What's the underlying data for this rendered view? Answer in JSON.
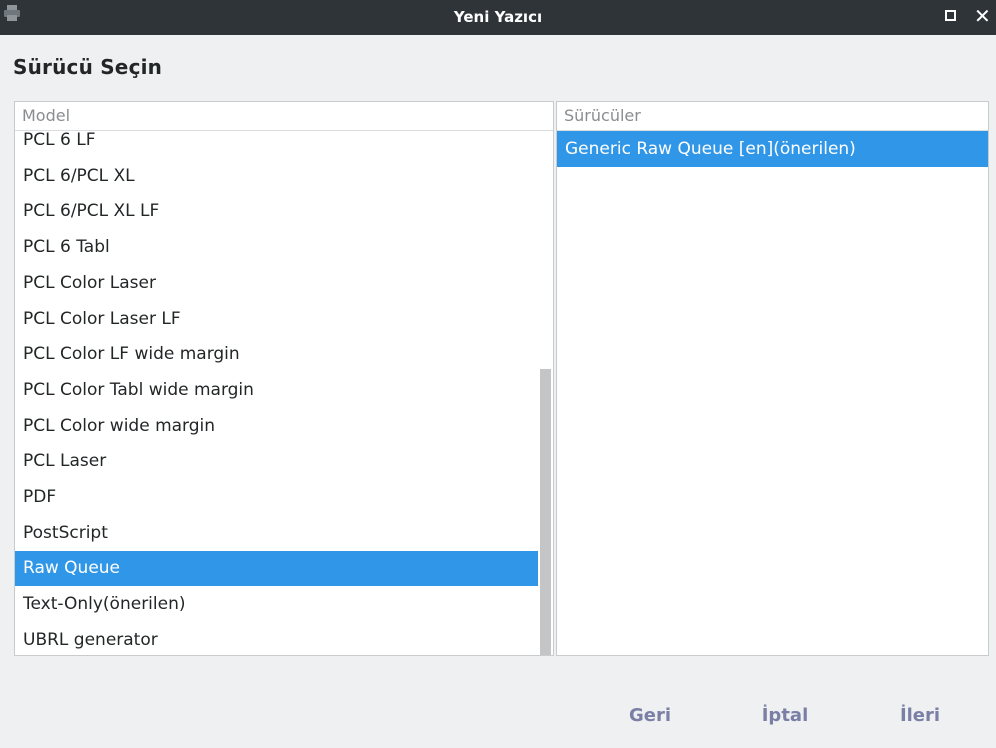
{
  "window": {
    "title": "Yeni Yazıcı",
    "icons": {
      "app": "printer-icon",
      "maximize": "maximize-icon",
      "close": "close-icon"
    },
    "close_glyph": "✕"
  },
  "heading": "Sürücü Seçin",
  "model_list": {
    "header": "Model",
    "items": [
      "PCL 6 LF",
      "PCL 6/PCL XL",
      "PCL 6/PCL XL LF",
      "PCL 6 Tabl",
      "PCL Color Laser",
      "PCL Color Laser LF",
      "PCL Color LF wide margin",
      "PCL Color Tabl wide margin",
      "PCL Color wide margin",
      "PCL Laser",
      "PDF",
      "PostScript",
      "Raw Queue",
      "Text-Only(önerilen)",
      "UBRL generator"
    ],
    "selected": "Raw Queue"
  },
  "driver_list": {
    "header": "Sürücüler",
    "items": [
      "Generic Raw Queue [en](önerilen)"
    ],
    "selected": "Generic Raw Queue [en](önerilen)"
  },
  "buttons": {
    "back": "Geri",
    "cancel": "İptal",
    "next": "İleri"
  },
  "colors": {
    "titlebar": "#2f3438",
    "selection": "#3096e8",
    "button_text": "#7a7fa6",
    "background": "#eff0f1"
  }
}
